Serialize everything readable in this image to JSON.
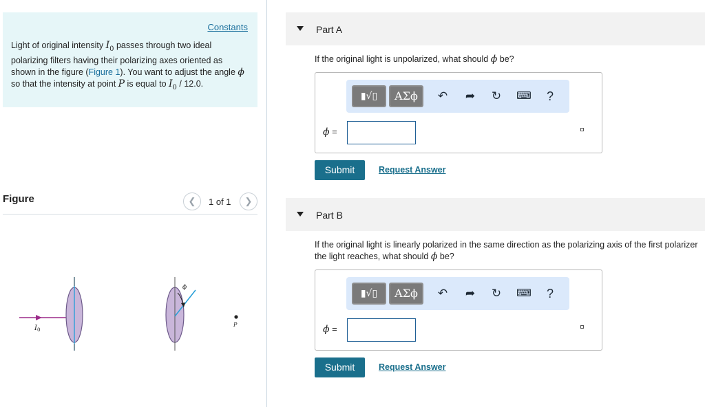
{
  "problem": {
    "constants_label": "Constants",
    "text_1": "Light of original intensity ",
    "I0": "I",
    "I0_sub": "0",
    "text_2": " passes through two ideal polarizing filters having their polarizing axes oriented as shown in the figure (",
    "figure_link": "Figure 1",
    "text_3": "). You want to adjust the angle ",
    "phi": "ϕ",
    "text_4": " so that the intensity at point ",
    "P": "P",
    "text_5": " is equal to ",
    "I0b": "I",
    "I0b_sub": "0",
    "text_6": " / 12.0."
  },
  "figure": {
    "title": "Figure",
    "prev_icon": "chevron-left-icon",
    "next_icon": "chevron-right-icon",
    "pager": "1 of 1",
    "label_I0": "I",
    "label_I0_sub": "0",
    "label_phi": "ϕ",
    "label_P": "P"
  },
  "parts": [
    {
      "title": "Part A",
      "question_1": "If the original light is unpolarized, what should ",
      "phi": "ϕ",
      "question_2": " be?",
      "input_label": "ϕ",
      "input_eq": " =",
      "input_value": "",
      "submit_label": "Submit",
      "request_label": "Request Answer"
    },
    {
      "title": "Part B",
      "question_1": "If the original light is linearly polarized in the same direction as the polarizing axis of the first polarizer the light reaches, what should ",
      "phi": "ϕ",
      "question_2": " be?",
      "input_label": "ϕ",
      "input_eq": " =",
      "input_value": "",
      "submit_label": "Submit",
      "request_label": "Request Answer"
    }
  ],
  "toolbar": {
    "templates_glyph": "▮√▯",
    "greek_glyph": "ΑΣϕ",
    "undo_icon": "undo-icon",
    "redo_icon": "redo-icon",
    "reset_icon": "reset-icon",
    "keyboard_icon": "keyboard-icon",
    "help_label": "?"
  },
  "colors": {
    "problem_bg": "#e6f6f8",
    "link": "#1a6f9c",
    "submit_bg": "#1a6f8c",
    "toolbar_bg": "#dbe9fb",
    "polarizer_fill": "#c9b6da",
    "polarizer_stroke": "#6d5a8a",
    "axis_line": "#2aa0d8",
    "light_ray": "#9c2a8a"
  }
}
